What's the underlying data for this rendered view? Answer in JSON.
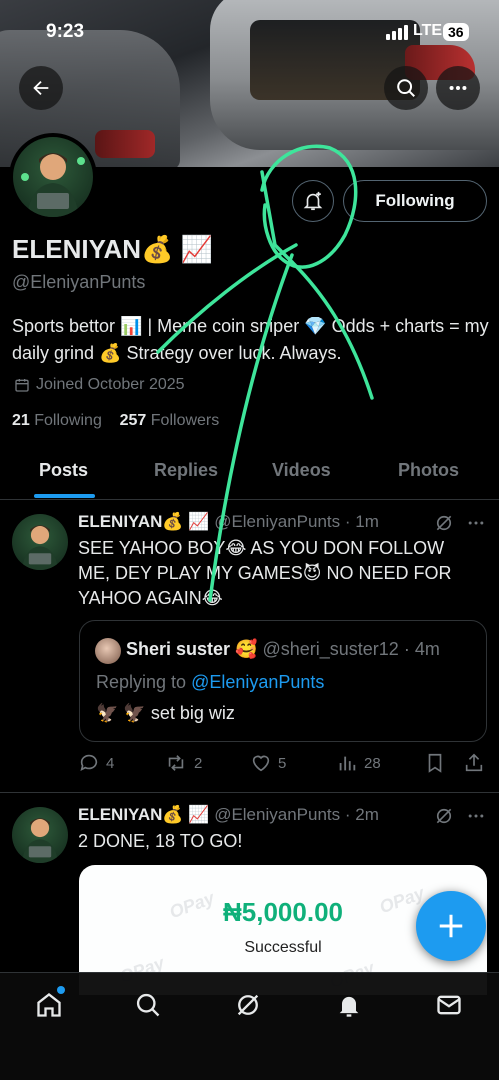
{
  "status_bar": {
    "time": "9:23",
    "network": "LTE",
    "battery": "36"
  },
  "profile": {
    "name": "ELENIYAN💰 📈",
    "handle": "@EleniyanPunts",
    "bio": "Sports bettor 📊 | Meme coin sniper 💎 Odds + charts = my daily grind 💰 Strategy over luck. Always.",
    "joined": "Joined October 2025",
    "following_count": "21",
    "following_label": "Following",
    "followers_count": "257",
    "followers_label": "Followers",
    "follow_button": "Following"
  },
  "tabs": [
    {
      "label": "Posts",
      "active": true
    },
    {
      "label": "Replies",
      "active": false
    },
    {
      "label": "Videos",
      "active": false
    },
    {
      "label": "Photos",
      "active": false
    }
  ],
  "posts": [
    {
      "author": "ELENIYAN💰 📈",
      "meta": "@EleniyanPunts · 1m",
      "text": "SEE YAHOO BOY😂 AS YOU DON FOLLOW ME, DEY PLAY MY GAMES😈 NO NEED FOR YAHOO AGAIN😂",
      "quote": {
        "author": "Sheri suster 🥰",
        "meta": "@sheri_suster12 · 4m",
        "replying_prefix": "Replying to",
        "replying_to": "@EleniyanPunts",
        "text": "🦅 🦅 set big wiz"
      },
      "replies": "4",
      "reposts": "2",
      "likes": "5",
      "views": "28"
    },
    {
      "author": "ELENIYAN💰 📈",
      "meta": "@EleniyanPunts · 2m",
      "text": "2 DONE, 18 TO GO!",
      "receipt": {
        "amount": "₦5,000.00",
        "status": "Successful",
        "watermark": "OPay"
      }
    }
  ],
  "colors": {
    "accent": "#1d9bf0",
    "muted": "#71767b",
    "scribble": "#3ee59b",
    "success": "#0fb07a"
  },
  "icons": {
    "back": "arrow-left-icon",
    "search": "search-icon",
    "more": "more-icon",
    "notify": "bell-plus-icon",
    "calendar": "calendar-icon",
    "nav": [
      "home-icon",
      "search-icon",
      "grok-icon",
      "bell-icon",
      "mail-icon"
    ]
  }
}
